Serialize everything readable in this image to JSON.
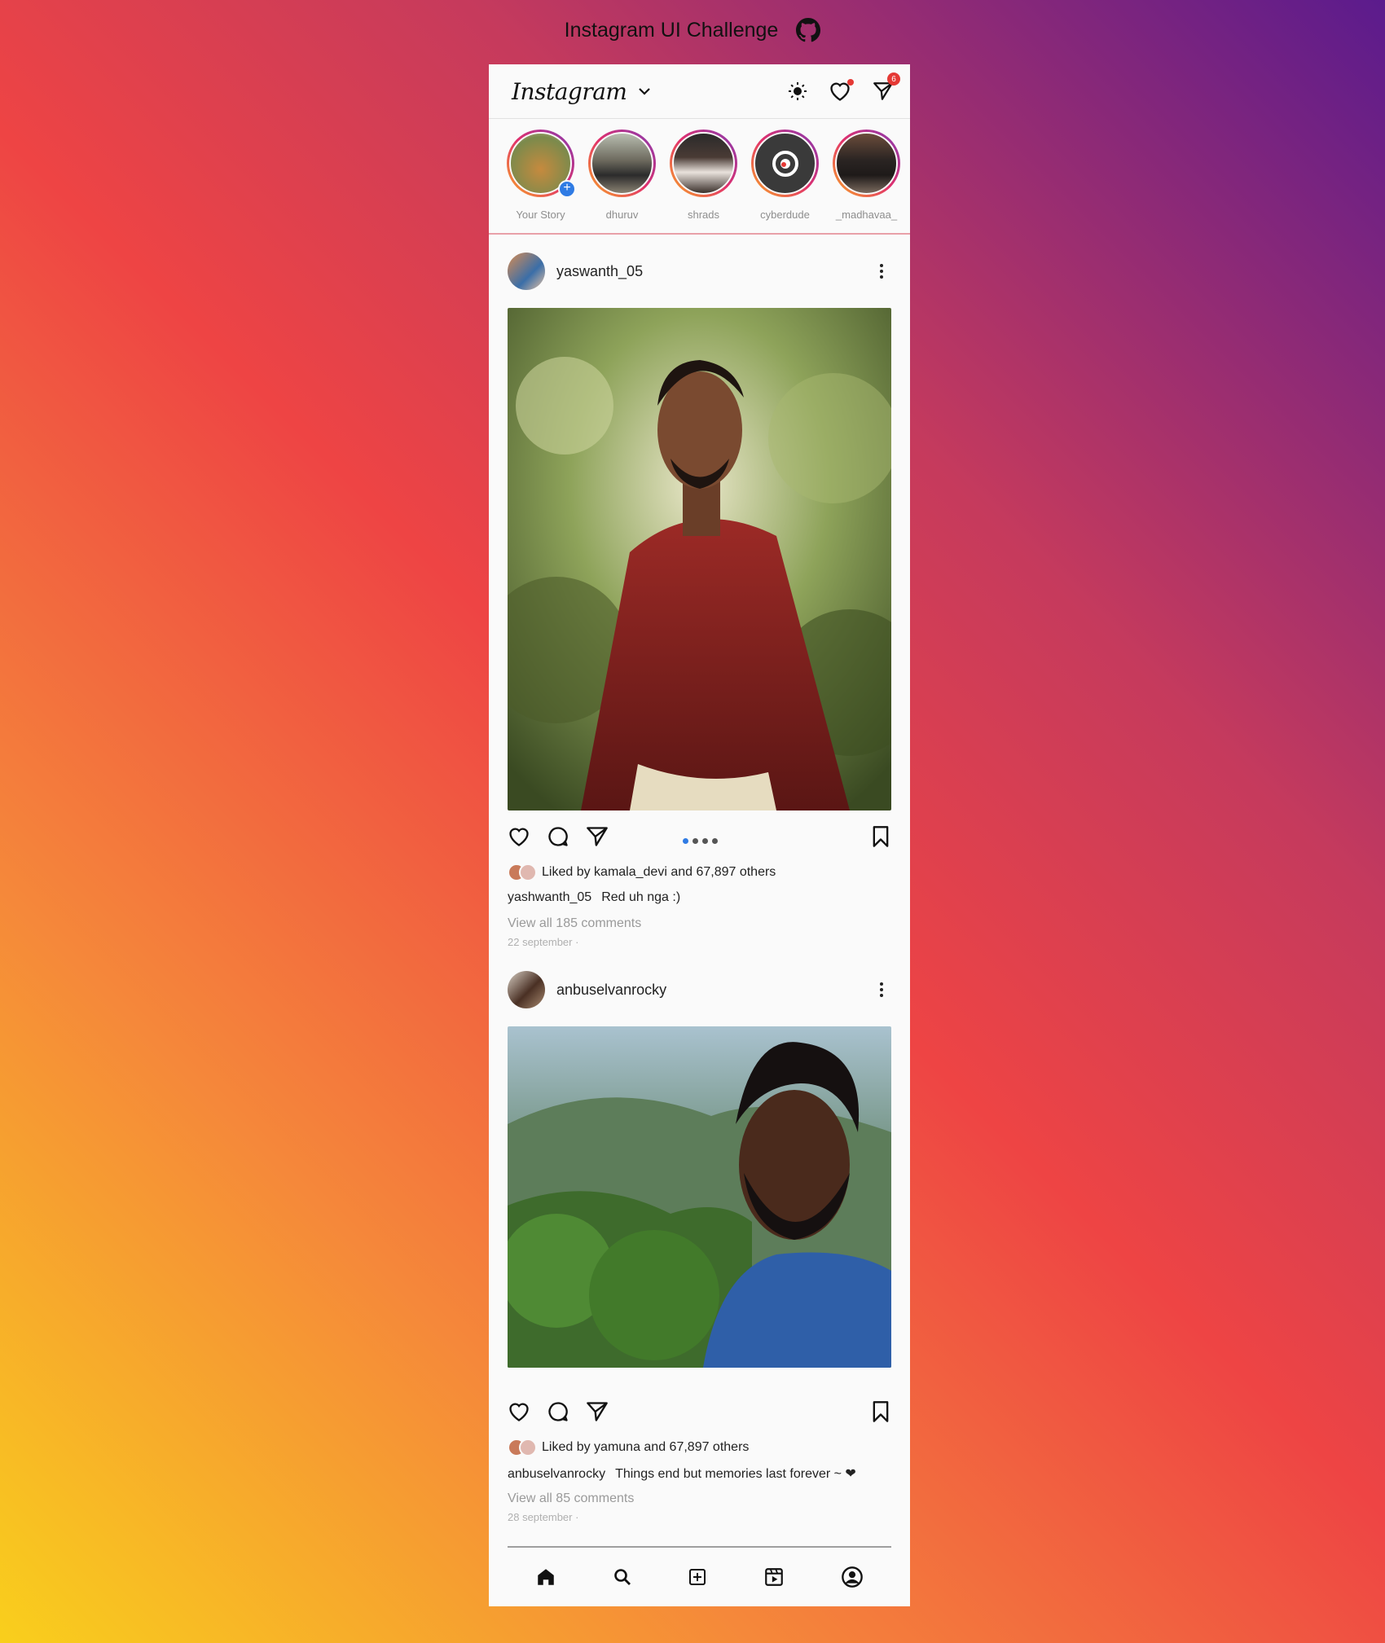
{
  "page": {
    "title": "Instagram UI Challenge"
  },
  "header": {
    "logo": "Instagram",
    "notif_count": "6"
  },
  "stories": [
    {
      "name": "Your Story",
      "own": true
    },
    {
      "name": "dhuruv"
    },
    {
      "name": "shrads"
    },
    {
      "name": "cyberdude"
    },
    {
      "name": "_madhavaa_"
    }
  ],
  "posts": [
    {
      "user": "yaswanth_05",
      "liked_by": "Liked by kamala_devi and 67,897 others",
      "caption_user": "yashwanth_05",
      "caption": "Red uh nga :)",
      "comments": "View all 185 comments",
      "date": "22 september ·"
    },
    {
      "user": "anbuselvanrocky",
      "liked_by": "Liked by yamuna and 67,897 others",
      "caption_user": "anbuselvanrocky",
      "caption": "Things end but memories last forever ~ ❤",
      "comments": "View all 85 comments",
      "date": "28 september ·"
    }
  ],
  "colors": {
    "accent": "#2f7be4",
    "badge": "#e53935",
    "ring_start": "#f9a825",
    "ring_end": "#833ab4"
  }
}
